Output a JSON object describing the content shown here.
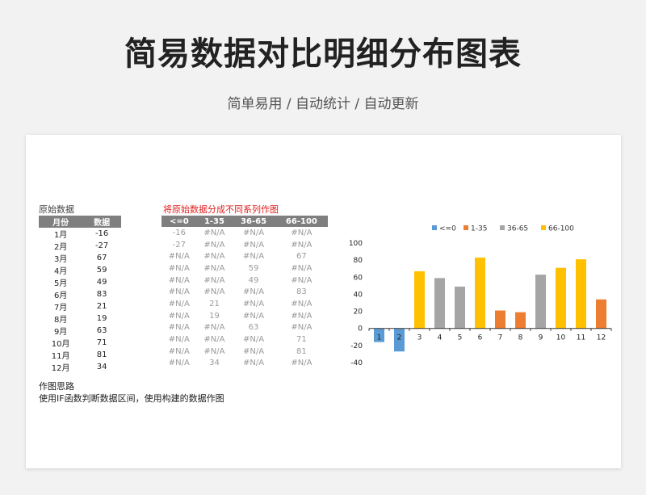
{
  "header": {
    "title": "简易数据对比明细分布图表",
    "subtitle": "简单易用 / 自动统计 / 自动更新"
  },
  "raw_section": {
    "label": "原始数据",
    "columns": [
      "月份",
      "数据"
    ],
    "rows": [
      [
        "1月",
        "-16"
      ],
      [
        "2月",
        "-27"
      ],
      [
        "3月",
        "67"
      ],
      [
        "4月",
        "59"
      ],
      [
        "5月",
        "49"
      ],
      [
        "6月",
        "83"
      ],
      [
        "7月",
        "21"
      ],
      [
        "8月",
        "19"
      ],
      [
        "9月",
        "63"
      ],
      [
        "10月",
        "71"
      ],
      [
        "11月",
        "81"
      ],
      [
        "12月",
        "34"
      ]
    ]
  },
  "split_section": {
    "label": "将原始数据分成不同系列作图",
    "columns": [
      "<=0",
      "1-35",
      "36-65",
      "66-100"
    ],
    "rows": [
      [
        "-16",
        "#N/A",
        "#N/A",
        "#N/A"
      ],
      [
        "-27",
        "#N/A",
        "#N/A",
        "#N/A"
      ],
      [
        "#N/A",
        "#N/A",
        "#N/A",
        "67"
      ],
      [
        "#N/A",
        "#N/A",
        "59",
        "#N/A"
      ],
      [
        "#N/A",
        "#N/A",
        "49",
        "#N/A"
      ],
      [
        "#N/A",
        "#N/A",
        "#N/A",
        "83"
      ],
      [
        "#N/A",
        "21",
        "#N/A",
        "#N/A"
      ],
      [
        "#N/A",
        "19",
        "#N/A",
        "#N/A"
      ],
      [
        "#N/A",
        "#N/A",
        "63",
        "#N/A"
      ],
      [
        "#N/A",
        "#N/A",
        "#N/A",
        "71"
      ],
      [
        "#N/A",
        "#N/A",
        "#N/A",
        "81"
      ],
      [
        "#N/A",
        "34",
        "#N/A",
        "#N/A"
      ]
    ]
  },
  "notes": {
    "title": "作图思路",
    "body": "使用IF函数判断数据区间，使用构建的数据作图"
  },
  "chart_data": {
    "type": "bar",
    "categories": [
      "1",
      "2",
      "3",
      "4",
      "5",
      "6",
      "7",
      "8",
      "9",
      "10",
      "11",
      "12"
    ],
    "ylim": [
      -40,
      100
    ],
    "yticks": [
      100,
      80,
      60,
      40,
      20,
      0,
      -20,
      -40
    ],
    "grid": false,
    "legend": "top",
    "series": [
      {
        "name": "<=0",
        "color": "#5b9bd5",
        "values": [
          -16,
          -27,
          null,
          null,
          null,
          null,
          null,
          null,
          null,
          null,
          null,
          null
        ]
      },
      {
        "name": "1-35",
        "color": "#ed7d31",
        "values": [
          null,
          null,
          null,
          null,
          null,
          null,
          21,
          19,
          null,
          null,
          null,
          34
        ]
      },
      {
        "name": "36-65",
        "color": "#a5a5a5",
        "values": [
          null,
          null,
          null,
          59,
          49,
          null,
          null,
          null,
          63,
          null,
          null,
          null
        ]
      },
      {
        "name": "66-100",
        "color": "#ffc000",
        "values": [
          null,
          null,
          67,
          null,
          null,
          83,
          null,
          null,
          null,
          71,
          81,
          null
        ]
      }
    ]
  }
}
